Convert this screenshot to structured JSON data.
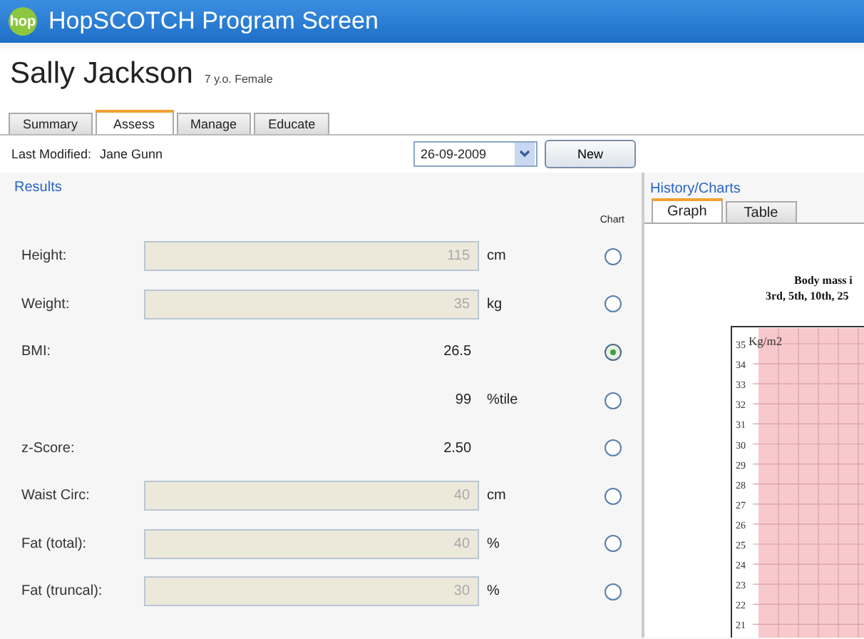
{
  "window": {
    "logo": "hop",
    "title": "HopSCOTCH Program Screen"
  },
  "patient": {
    "name": "Sally Jackson",
    "details": "7 y.o. Female"
  },
  "tabs": [
    {
      "label": "Summary",
      "selected": false
    },
    {
      "label": "Assess",
      "selected": true
    },
    {
      "label": "Manage",
      "selected": false
    },
    {
      "label": "Educate",
      "selected": false
    }
  ],
  "toolbar": {
    "last_modified_label": "Last Modified:",
    "last_modified_by": "Jane Gunn",
    "date": "26-09-2009",
    "new_button": "New"
  },
  "results": {
    "heading": "Results",
    "chart_column": "Chart",
    "rows": [
      {
        "kind": "input",
        "label": "Height:",
        "value": "115",
        "unit": "cm",
        "chart_selected": false
      },
      {
        "kind": "input",
        "label": "Weight:",
        "value": "35",
        "unit": "kg",
        "chart_selected": false
      },
      {
        "kind": "value",
        "label": "BMI:",
        "value": "26.5",
        "chart_selected": true
      },
      {
        "kind": "value",
        "value": "99",
        "unit": "%tile",
        "chart_selected": false
      },
      {
        "kind": "value",
        "label": "z-Score:",
        "value": "2.50",
        "chart_selected": false
      },
      {
        "kind": "input",
        "label": "Waist Circ:",
        "value": "40",
        "unit": "cm",
        "chart_selected": false
      },
      {
        "kind": "input",
        "label": "Fat (total):",
        "value": "40",
        "unit": "%",
        "chart_selected": false
      },
      {
        "kind": "input",
        "label": "Fat (truncal):",
        "value": "30",
        "unit": "%",
        "chart_selected": false
      }
    ]
  },
  "history": {
    "heading": "History/Charts",
    "tabs": [
      {
        "label": "Graph",
        "selected": true
      },
      {
        "label": "Table",
        "selected": false
      }
    ],
    "graph": {
      "title_lines": [
        "Body mass i",
        "3rd, 5th, 10th, 25"
      ],
      "y_unit": "Kg/m2",
      "y_labels": [
        "35",
        "34",
        "33",
        "32",
        "31",
        "30",
        "29",
        "28",
        "27",
        "26",
        "25",
        "24",
        "23",
        "22",
        "21"
      ]
    }
  }
}
